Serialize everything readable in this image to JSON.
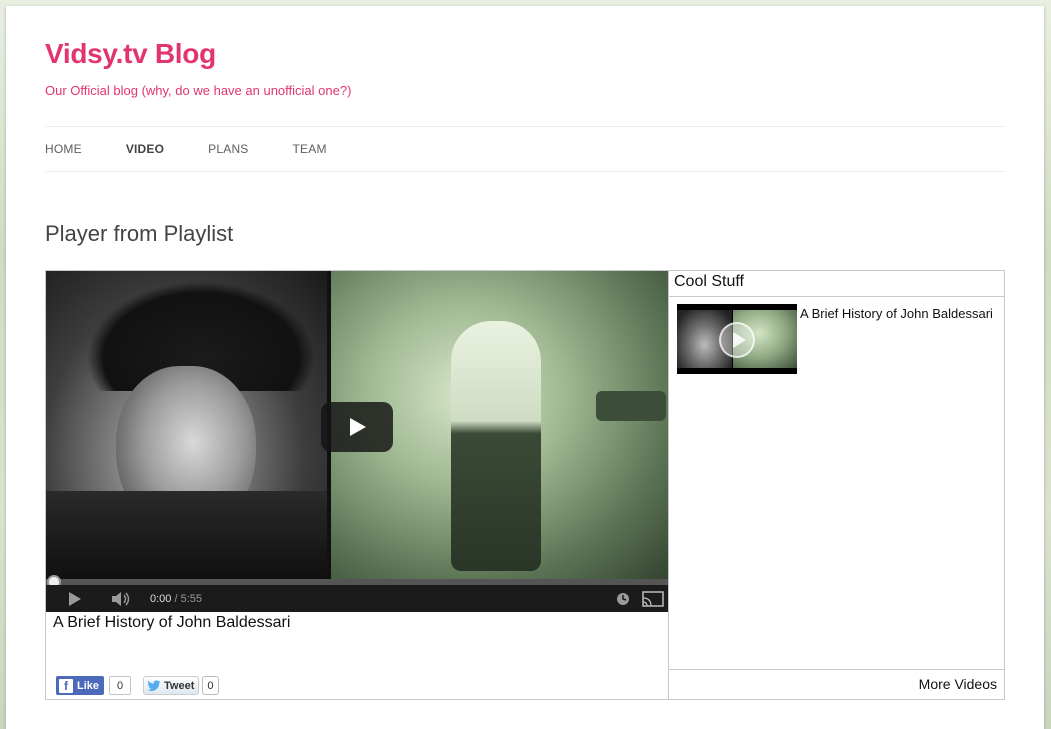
{
  "site": {
    "title": "Vidsy.tv Blog",
    "description": "Our Official blog (why, do we have an unofficial one?)"
  },
  "nav": {
    "items": [
      {
        "label": "HOME",
        "active": false
      },
      {
        "label": "VIDEO",
        "active": true
      },
      {
        "label": "PLANS",
        "active": false
      },
      {
        "label": "TEAM",
        "active": false
      }
    ]
  },
  "entry": {
    "title": "Player from Playlist"
  },
  "player": {
    "current_time": "0:00",
    "duration": " / 5:55",
    "progress_fraction": 0,
    "video_title": "A Brief History of John Baldessari",
    "icons": {
      "play": "play-icon",
      "volume": "volume-icon",
      "clock": "clock-icon",
      "cast": "cast-icon"
    }
  },
  "social": {
    "like_label": "Like",
    "like_count": "0",
    "tweet_label": "Tweet",
    "tweet_count": "0"
  },
  "playlist": {
    "title": "Cool Stuff",
    "items": [
      {
        "label": "A Brief History of John Baldessari"
      }
    ],
    "more_label": "More Videos"
  },
  "colors": {
    "brand": "#e2356f",
    "facebook": "#4c69ba"
  }
}
